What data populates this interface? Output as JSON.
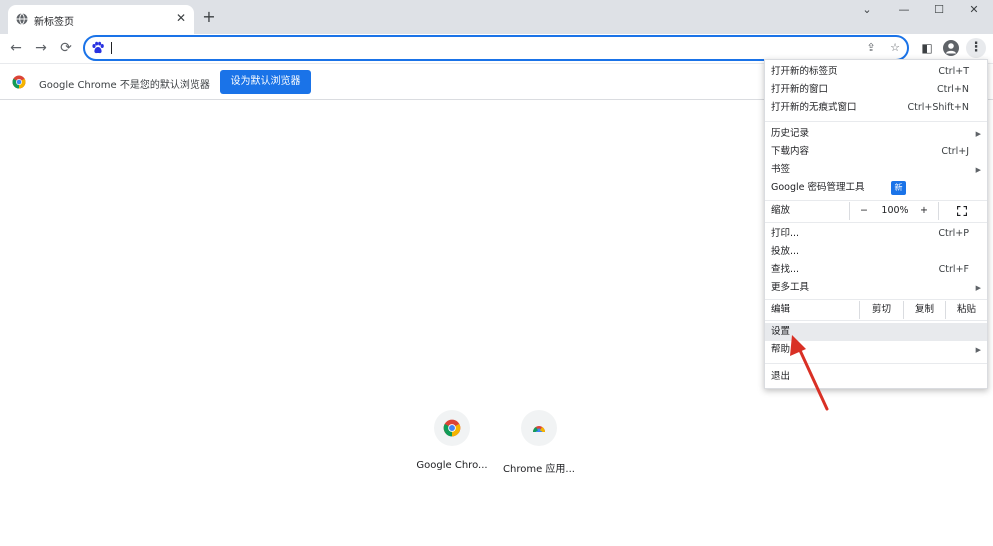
{
  "tabbar": {
    "tab_title": "新标签页",
    "close_glyph": "✕",
    "new_tab_glyph": "+",
    "window_controls": {
      "collapse": "⌄",
      "minimize": "—",
      "maximize": "☐",
      "close": "✕"
    }
  },
  "toolbar": {
    "back_glyph": "←",
    "forward_glyph": "→",
    "reload_glyph": "⟳",
    "omnibox_value": "",
    "share_glyph": "⇪",
    "bookmark_glyph": "☆",
    "side_panel_glyph": "◧",
    "menu_glyph": "⋮"
  },
  "infobar": {
    "message": "Google Chrome 不是您的默认浏览器",
    "button_label": "设为默认浏览器"
  },
  "shortcuts": [
    {
      "label": "Google Chro..."
    },
    {
      "label": "Chrome 应用..."
    }
  ],
  "menu": {
    "new_tab": {
      "label": "打开新的标签页",
      "shortcut": "Ctrl+T"
    },
    "new_window": {
      "label": "打开新的窗口",
      "shortcut": "Ctrl+N"
    },
    "new_incognito": {
      "label": "打开新的无痕式窗口",
      "shortcut": "Ctrl+Shift+N"
    },
    "history": {
      "label": "历史记录",
      "arrow": "▶"
    },
    "downloads": {
      "label": "下载内容",
      "shortcut": "Ctrl+J"
    },
    "bookmarks": {
      "label": "书签",
      "arrow": "▶"
    },
    "password_manager": {
      "label": "Google 密码管理工具",
      "badge": "新"
    },
    "zoom": {
      "label": "缩放",
      "minus": "−",
      "value": "100%",
      "plus": "+"
    },
    "print": {
      "label": "打印...",
      "shortcut": "Ctrl+P"
    },
    "cast": {
      "label": "投放..."
    },
    "find": {
      "label": "查找...",
      "shortcut": "Ctrl+F"
    },
    "more_tools": {
      "label": "更多工具",
      "arrow": "▶"
    },
    "edit": {
      "label": "编辑",
      "cut": "剪切",
      "copy": "复制",
      "paste": "粘贴"
    },
    "settings": {
      "label": "设置"
    },
    "help": {
      "label": "帮助",
      "arrow": "▶"
    },
    "exit": {
      "label": "退出"
    }
  },
  "colors": {
    "accent": "#1a73e8",
    "tabbar_bg": "#dee1e6",
    "annotation_arrow": "#d93025"
  }
}
